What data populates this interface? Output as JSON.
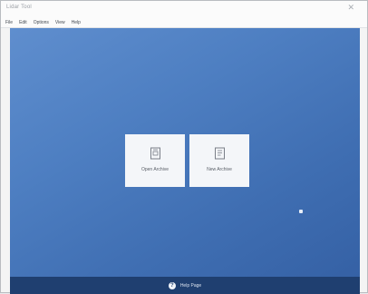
{
  "window": {
    "title": "Lidar Tool",
    "close_glyph": "✕"
  },
  "menu": [
    {
      "label": "File",
      "interactable": true
    },
    {
      "label": "Edit",
      "interactable": true
    },
    {
      "label": "Options",
      "interactable": true
    },
    {
      "label": "View",
      "interactable": true
    },
    {
      "label": "Help",
      "interactable": true
    }
  ],
  "start": {
    "tiles": [
      {
        "name": "open-archive-tile",
        "label": "Open Archive",
        "icon": "archive-icon"
      },
      {
        "name": "new-archive-tile",
        "label": "New Archive",
        "icon": "new-document-icon"
      }
    ]
  },
  "footer": {
    "help_glyph": "?",
    "label": "Help Page"
  },
  "colors": {
    "workspace_top": "#5f8ece",
    "workspace_bottom": "#3561a5",
    "footer": "#1f3f70",
    "tile": "#f4f6f9"
  }
}
